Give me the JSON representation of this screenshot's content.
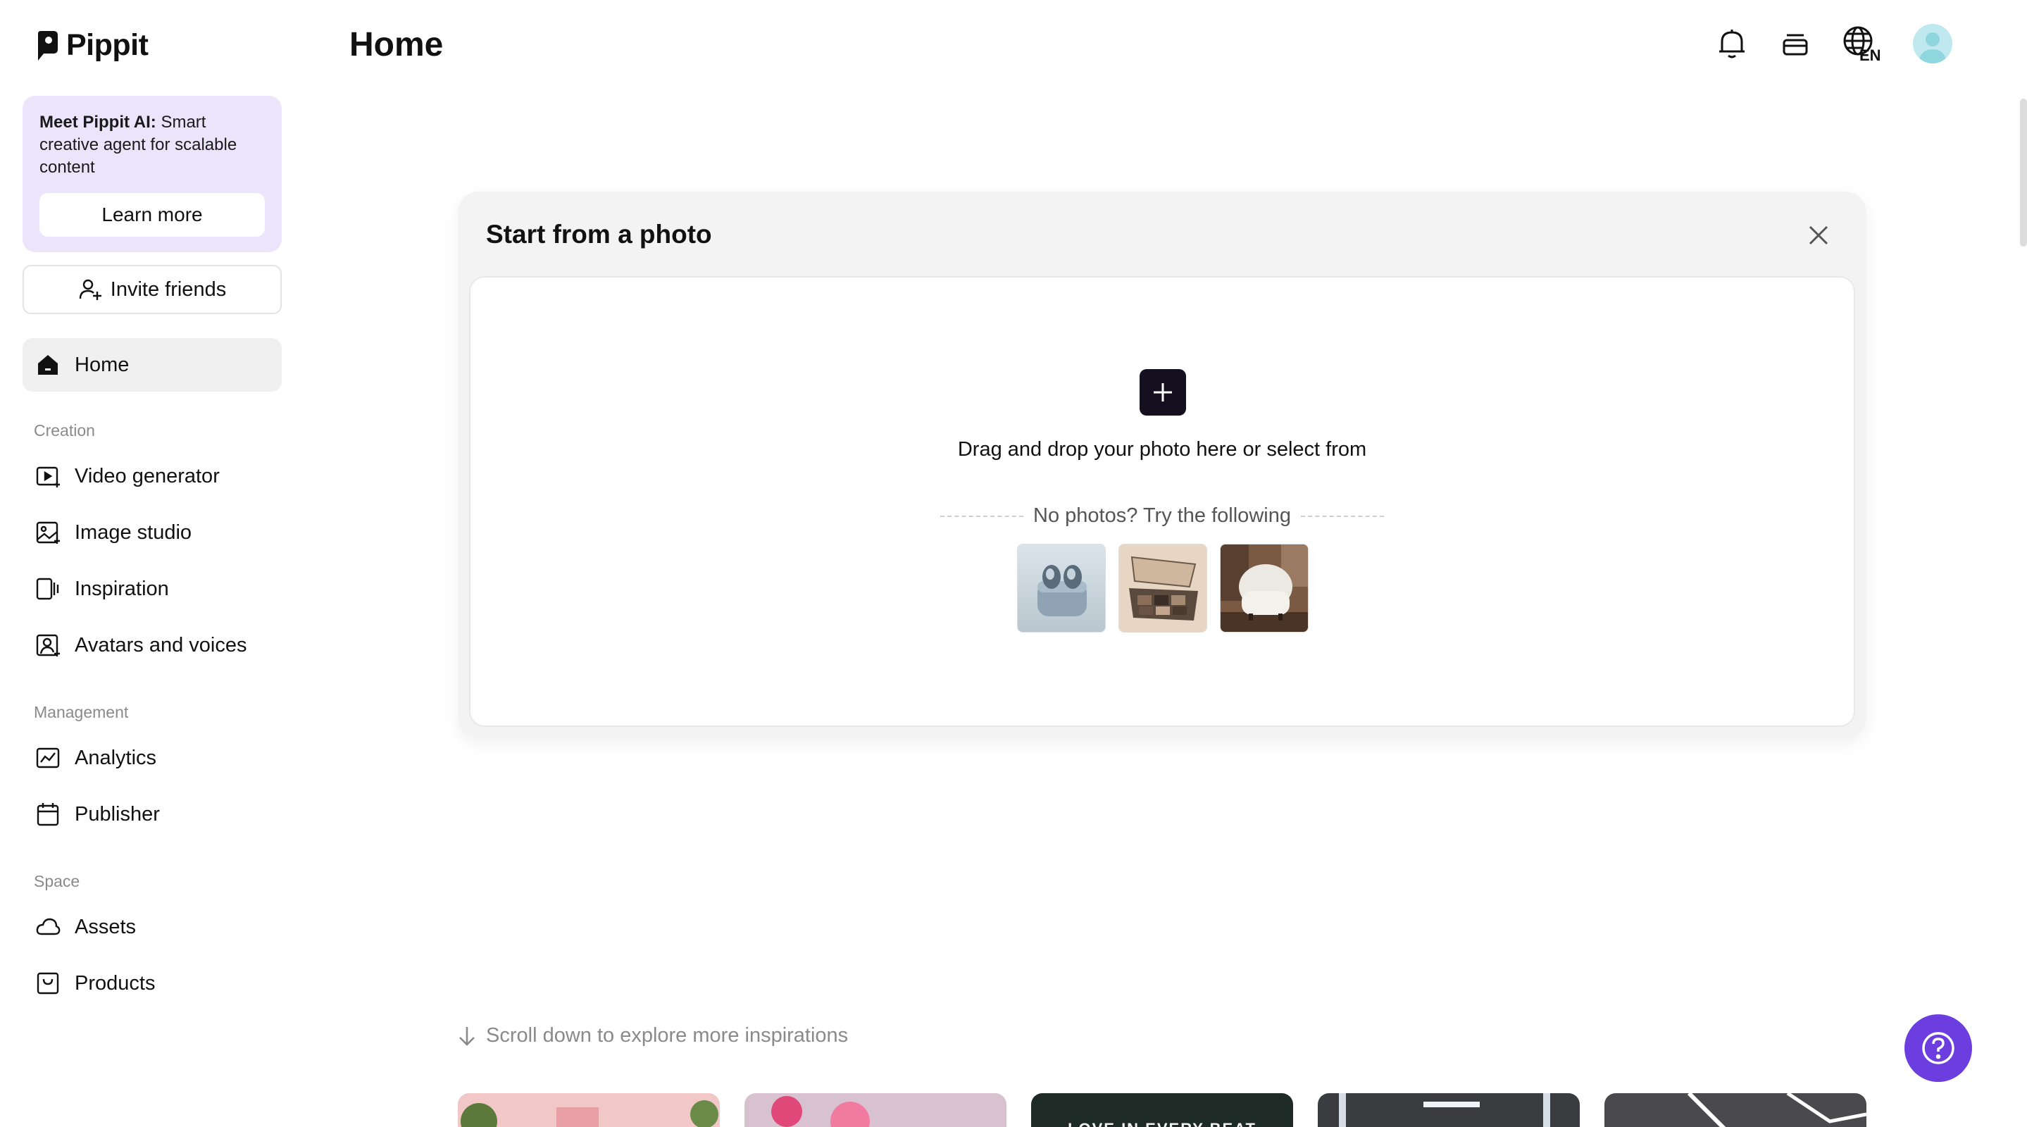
{
  "app": {
    "name": "Pippit"
  },
  "sidebar": {
    "promo": {
      "bold": "Meet Pippit AI:",
      "text": " Smart creative agent for scalable content",
      "button": "Learn more"
    },
    "invite_label": "Invite friends",
    "home_label": "Home",
    "sections": {
      "creation": "Creation",
      "management": "Management",
      "space": "Space"
    },
    "creation_items": [
      "Video generator",
      "Image studio",
      "Inspiration",
      "Avatars and voices"
    ],
    "management_items": [
      "Analytics",
      "Publisher"
    ],
    "space_items": [
      "Assets",
      "Products"
    ]
  },
  "header": {
    "title": "Home",
    "language_badge": "EN"
  },
  "upload_card": {
    "title": "Start from a photo",
    "drop_text": "Drag and drop your photo here or select from",
    "sample_text": "No photos? Try the following",
    "samples": [
      "earbuds-sample",
      "eyeshadow-palette-sample",
      "armchair-sample"
    ]
  },
  "bottom": {
    "scroll_hint": "Scroll down to explore more inspirations",
    "inspiration_teaser_text": "LOVE IN EVERY BEAT"
  },
  "colors": {
    "accent": "#6c3ddf",
    "promo_bg": "#ece4fb",
    "active_nav": "#f0f0f0"
  }
}
